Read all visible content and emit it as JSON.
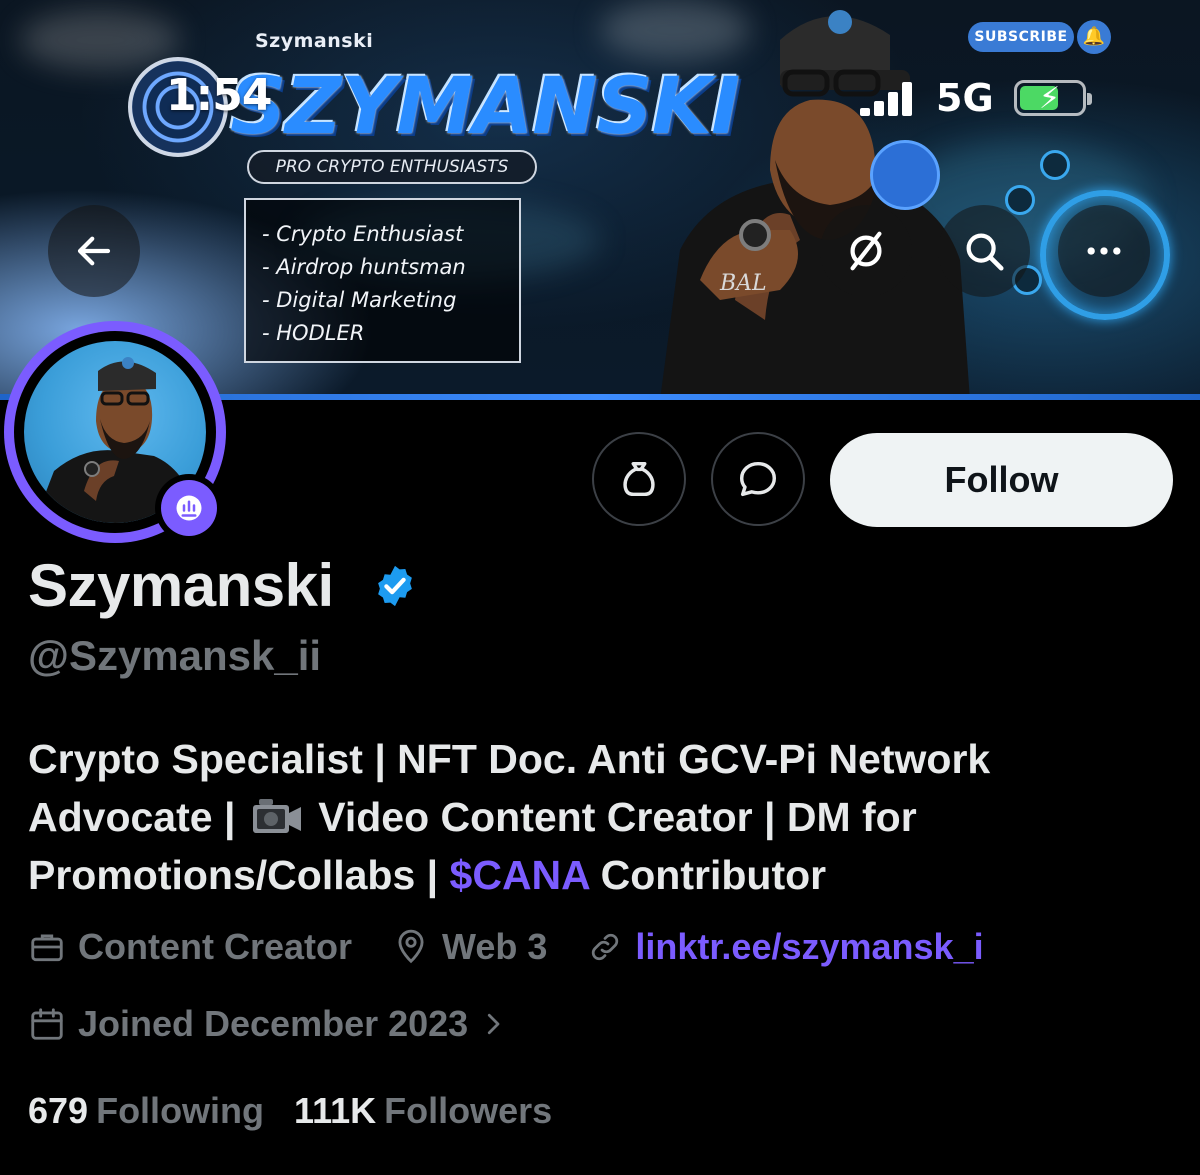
{
  "status_bar": {
    "time": "1:54",
    "network": "5G"
  },
  "banner": {
    "brand_small": "Szymanski",
    "brand_big": "SZYMANSKI",
    "tagline": "PRO CRYPTO ENTHUSIASTS",
    "skills": [
      "- Crypto Enthusiast",
      "- Airdrop huntsman",
      "- Digital Marketing",
      "- HODLER"
    ],
    "subscribe_label": "SUBSCRIBE",
    "shirt_text": "BAL"
  },
  "header_buttons": {
    "back_icon": "arrow-left-icon",
    "grok_icon": "slash-circle-icon",
    "search_icon": "search-icon",
    "more_icon": "more-icon"
  },
  "actions": {
    "tip_icon": "money-bag-icon",
    "message_icon": "message-icon",
    "follow_label": "Follow"
  },
  "profile": {
    "display_name": "Szymanski",
    "handle": "@Szymansk_ii",
    "bio_part1": "Crypto Specialist | NFT Doc. Anti GCV-Pi Network Advocate |",
    "bio_part2": "Video Content Creator | DM for Promotions/Collabs |",
    "bio_cashtag": "$CANA",
    "bio_part3": "Contributor",
    "category": "Content Creator",
    "location": "Web 3",
    "link": "linktr.ee/szymansk_i",
    "joined": "Joined December 2023"
  },
  "stats": {
    "following_count": "679",
    "following_label": "Following",
    "followers_count": "111K",
    "followers_label": "Followers"
  },
  "colors": {
    "accent": "#7b5cff",
    "verified": "#1d9bf0",
    "muted": "#71767b"
  }
}
